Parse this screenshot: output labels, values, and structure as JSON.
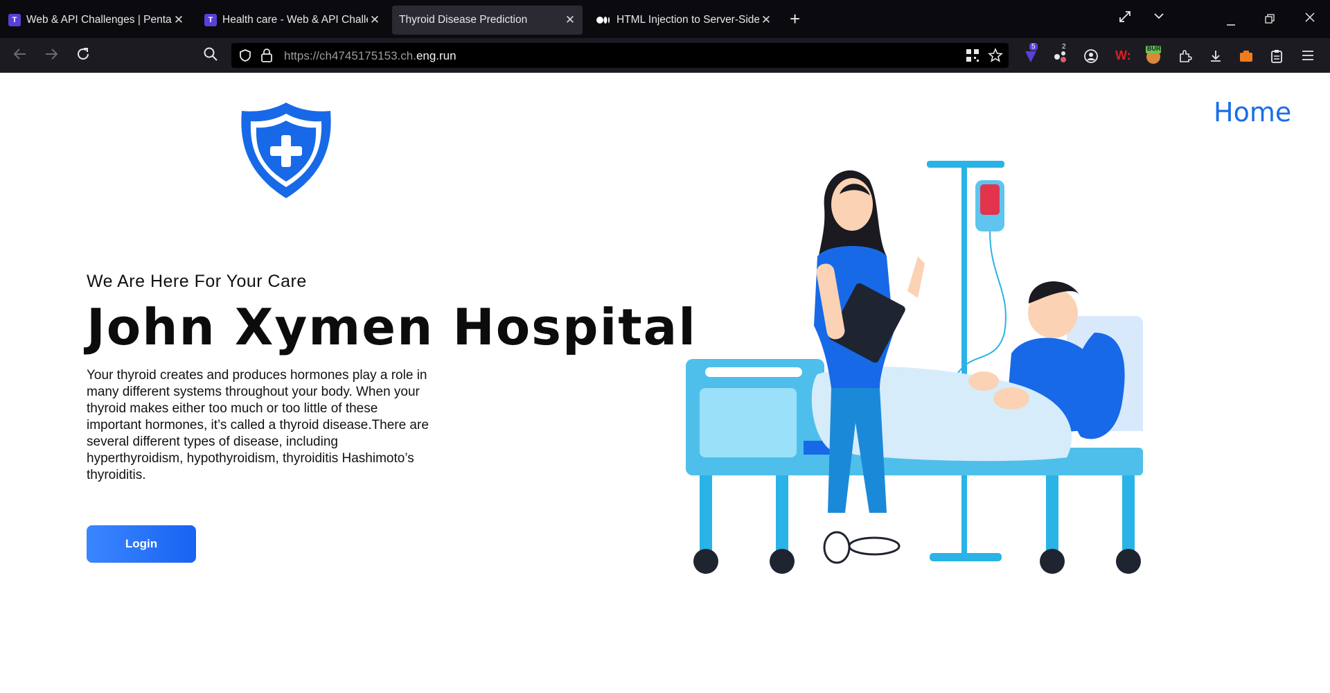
{
  "browser": {
    "tabs": [
      {
        "title": "Web & API Challenges | Pentathon",
        "active": false,
        "icon": "purple-T-icon"
      },
      {
        "title": "Health care - Web & API Challenge",
        "active": false,
        "icon": "purple-T-icon"
      },
      {
        "title": "Thyroid Disease Prediction",
        "active": true,
        "icon": ""
      },
      {
        "title": "HTML Injection to Server-Side Request",
        "active": false,
        "icon": "medium-icon"
      }
    ],
    "url_prefix": "https://ch4745175153.ch.",
    "url_domain": "eng.run",
    "badges": {
      "ext_count_1": "5",
      "ext_count_2": "2",
      "ext_bur": "BUR"
    }
  },
  "page": {
    "nav_home": "Home",
    "tagline": "We Are Here For Your Care",
    "title": "John Xymen Hospital",
    "description": "Your thyroid creates and produces hormones play a role in many different systems throughout your body. When your thyroid makes either too much or too little of these important hormones, it’s called a thyroid disease.There are several different types of disease, including hyperthyroidism, hypothyroidism, thyroiditis Hashimoto’s thyroiditis.",
    "login_label": "Login"
  },
  "colors": {
    "accent": "#1a6ee8",
    "tab_bg": "#0b0b0f",
    "toolbar_bg": "#1c1b22",
    "button_gradient_start": "#3b86ff",
    "button_gradient_end": "#1863f2"
  }
}
